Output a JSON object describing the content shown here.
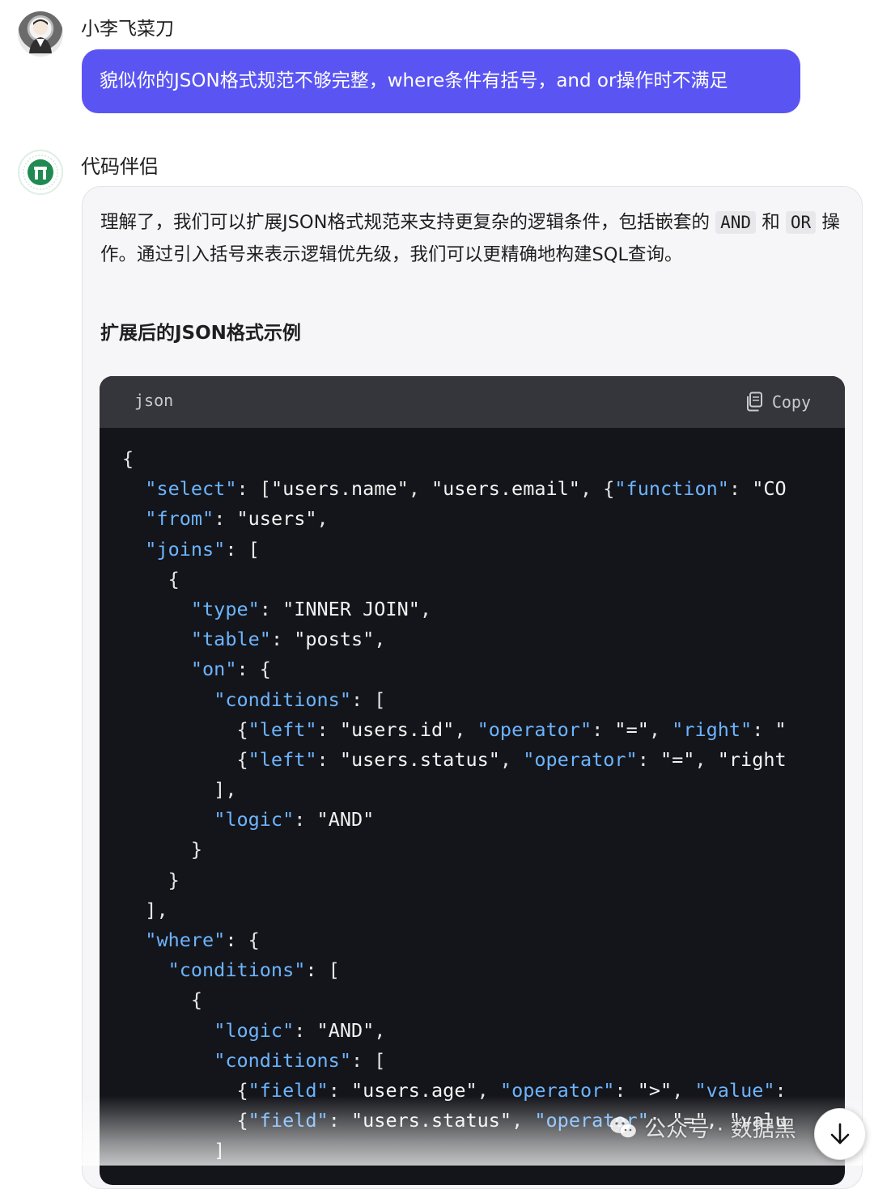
{
  "user": {
    "name": "小李飞菜刀",
    "message": "貌似你的JSON格式规范不够完整，where条件有括号，and or操作时不满足"
  },
  "bot": {
    "name": "代码伴侣",
    "para_1a": "理解了，我们可以扩展JSON格式规范来支持更复杂的逻辑条件，包括嵌套的 ",
    "para_code_and": "AND",
    "para_1b": " 和 ",
    "para_code_or": "OR",
    "para_1c": " 操作。通过引入括号来表示逻辑优先级，我们可以更精确地构建SQL查询。",
    "section_heading": "扩展后的JSON格式示例",
    "code": {
      "language": "json",
      "copy_label": "Copy",
      "lines": [
        "{",
        "  \"select\": [\"users.name\", \"users.email\", {\"function\": \"CO",
        "  \"from\": \"users\",",
        "  \"joins\": [",
        "    {",
        "      \"type\": \"INNER JOIN\",",
        "      \"table\": \"posts\",",
        "      \"on\": {",
        "        \"conditions\": [",
        "          {\"left\": \"users.id\", \"operator\": \"=\", \"right\": \"",
        "          {\"left\": \"users.status\", \"operator\": \"=\", \"right",
        "        ],",
        "        \"logic\": \"AND\"",
        "      }",
        "    }",
        "  ],",
        "  \"where\": {",
        "    \"conditions\": [",
        "      {",
        "        \"logic\": \"AND\",",
        "        \"conditions\": [",
        "          {\"field\": \"users.age\", \"operator\": \">\", \"value\":",
        "          {\"field\": \"users.status\", \"operator\": \"=\", \"valu",
        "        ]"
      ]
    }
  },
  "watermark": "公众号 · 数据黑",
  "icons": {
    "copy": "copy-icon",
    "scroll_down": "arrow-down-icon",
    "watermark": "wechat-icon"
  }
}
